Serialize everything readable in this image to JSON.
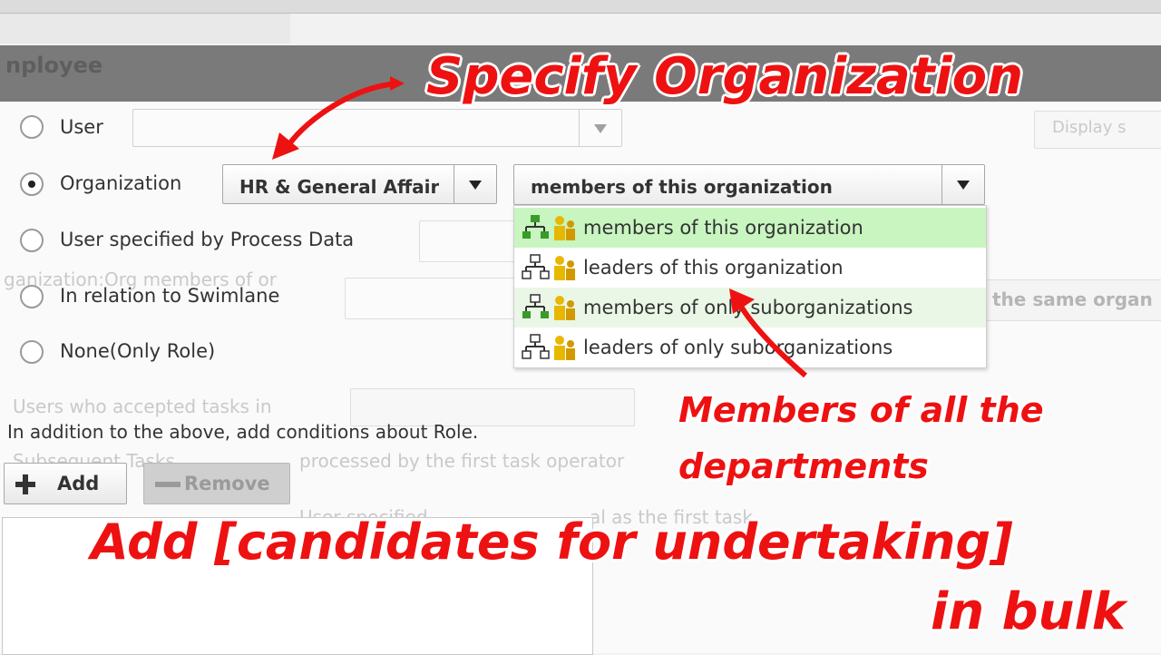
{
  "header": {
    "title": "nployee"
  },
  "background_text": {
    "org_specified": "ganization:Org members of or",
    "display_btn": "Display s",
    "same_org": "the same organ",
    "accepted_tasks": "Users who accepted tasks in",
    "subsequent": "Subsequent Tasks",
    "processed": "processed by the first task operator",
    "specified_partial": "User specified",
    "specified_tail": "al as the first task"
  },
  "assign": {
    "options": [
      {
        "label": "User",
        "checked": false
      },
      {
        "label": "Organization",
        "checked": true
      },
      {
        "label": "User specified by Process Data",
        "checked": false
      },
      {
        "label": "In relation to Swimlane",
        "checked": false
      },
      {
        "label": "None(Only Role)",
        "checked": false
      }
    ]
  },
  "org_select": {
    "value": "HR & General Affairs"
  },
  "scope_select": {
    "value": "members of this organization"
  },
  "scope_options": [
    {
      "label": "members of this organization",
      "state": "selected"
    },
    {
      "label": "leaders of this organization",
      "state": "normal"
    },
    {
      "label": "members of only suborganizations",
      "state": "hover"
    },
    {
      "label": "leaders of only suborganizations",
      "state": "normal"
    }
  ],
  "info_text": "In addition to the above, add conditions about Role.",
  "buttons": {
    "add": "Add",
    "remove": "Remove"
  },
  "annotations": {
    "top": "Specify Organization",
    "middle_line1": "Members of all the",
    "middle_line2": "departments",
    "bottom_line1": "Add [candidates for undertaking]",
    "bottom_line2": "in bulk"
  },
  "colors": {
    "annotation": "#ee1111",
    "selected_option": "#c8f5c0",
    "hover_option": "#eaf7e6",
    "icon_green": "#3a9a2a",
    "icon_yellow": "#e8b800"
  }
}
